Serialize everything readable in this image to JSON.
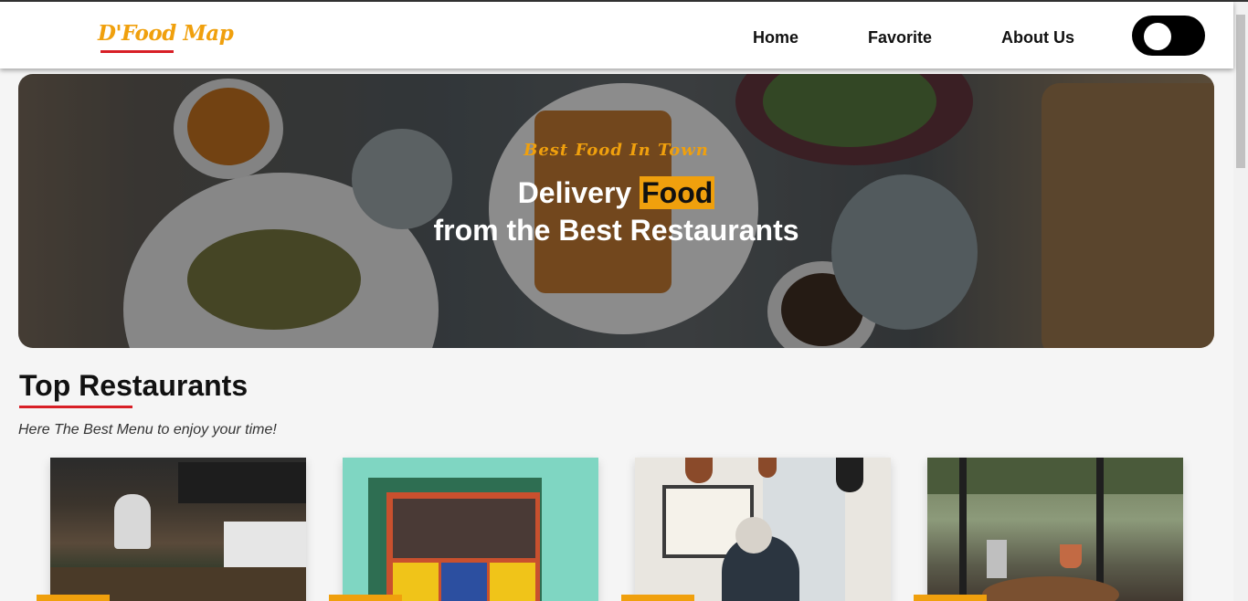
{
  "brand": {
    "logo_text": "D'Food Map"
  },
  "nav": {
    "items": [
      {
        "label": "Home"
      },
      {
        "label": "Favorite"
      },
      {
        "label": "About Us"
      }
    ]
  },
  "hero": {
    "eyebrow": "Best Food In Town",
    "title_line1_prefix": "Delivery ",
    "title_highlight": "Food",
    "title_line2": "from the Best Restaurants"
  },
  "section": {
    "title": "Top Restaurants",
    "subtitle": "Here The Best Menu to enjoy your time!"
  },
  "restaurants": [
    {
      "image": "cafe-kitchen-photo"
    },
    {
      "image": "teal-storefront-photo"
    },
    {
      "image": "cafe-window-photo"
    },
    {
      "image": "greenhouse-cafe-photo"
    }
  ],
  "colors": {
    "accent": "#f0a00d",
    "underline": "#d81f26",
    "toggle": "#000000"
  }
}
